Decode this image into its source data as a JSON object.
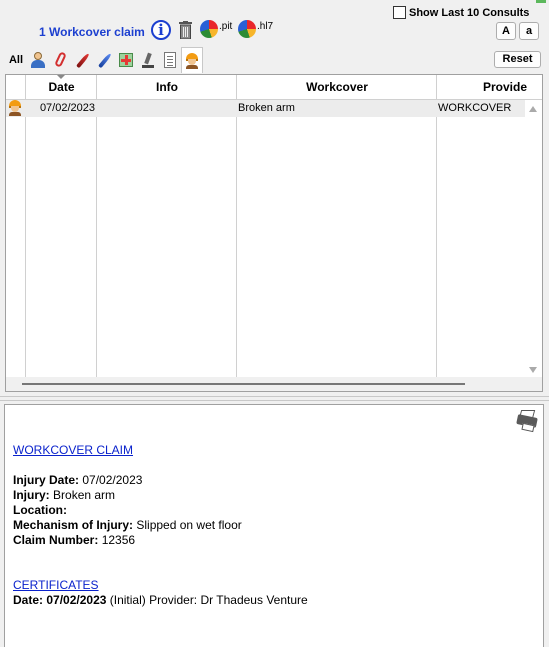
{
  "header": {
    "title": "1 Workcover claim",
    "info_icon_glyph": "i",
    "export_pit_label": ".pit",
    "export_hl7_label": ".hl7",
    "show_last_consults_label": "Show Last 10 Consults",
    "show_last_consults_checked": false,
    "font_large_label": "A",
    "font_small_label": "a",
    "reset_label": "Reset"
  },
  "tabs": {
    "all_label": "All",
    "icons": [
      "person-icon",
      "paperclip-icon",
      "red-quill-icon",
      "blue-quill-icon",
      "medical-kit-icon",
      "microscope-icon",
      "document-icon",
      "worker-icon"
    ],
    "selected": "worker-icon"
  },
  "table": {
    "columns": [
      "Date",
      "Info",
      "Workcover",
      "Provide"
    ],
    "rows": [
      {
        "icon": "worker-icon",
        "date": "07/02/2023",
        "info": "",
        "workcover": "Broken arm",
        "provider": "WORKCOVER"
      }
    ]
  },
  "detail": {
    "section1_title": "WORKCOVER CLAIM",
    "injury_date_label": "Injury Date:",
    "injury_date_value": "07/02/2023",
    "injury_label": "Injury:",
    "injury_value": "Broken arm",
    "location_label": "Location:",
    "location_value": "",
    "mechanism_label": "Mechanism of Injury:",
    "mechanism_value": "Slipped on wet floor",
    "claim_number_label": "Claim Number:",
    "claim_number_value": "12356",
    "section2_title": "CERTIFICATES",
    "cert_date_label": "Date:",
    "cert_date_value": "07/02/2023",
    "cert_type": "(Initial)",
    "cert_provider_label": "Provider:",
    "cert_provider_value": "Dr Thadeus Venture"
  },
  "colors": {
    "title": "#1c3fd0",
    "link": "#0a22cc",
    "row_bg": "#ececec",
    "pane_bg": "#ffffff",
    "window_bg": "#f0f0f0"
  }
}
